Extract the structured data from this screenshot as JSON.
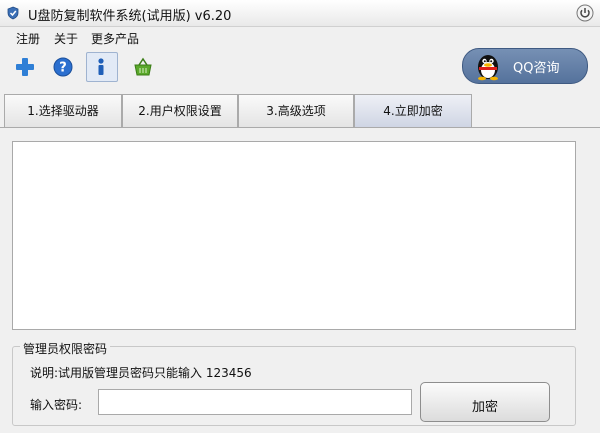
{
  "window": {
    "title": "U盘防复制软件系统(试用版) v6.20",
    "app_icon": "shield-icon",
    "close_icon": "power-icon"
  },
  "menu": {
    "items": [
      {
        "label": "注册"
      },
      {
        "label": "关于"
      },
      {
        "label": "更多产品"
      }
    ]
  },
  "toolbar": {
    "icons": [
      "plus-icon",
      "help-icon",
      "info-icon",
      "basket-icon"
    ],
    "qq_label": "QQ咨询"
  },
  "tabs": [
    {
      "label": "1.选择驱动器"
    },
    {
      "label": "2.用户权限设置"
    },
    {
      "label": "3.高级选项"
    },
    {
      "label": "4.立即加密",
      "active": true
    }
  ],
  "admin_group": {
    "title": "管理员权限密码",
    "hint": "说明:试用版管理员密码只能输入 123456",
    "password_label": "输入密码:",
    "password_value": "",
    "encrypt_label": "加密"
  },
  "colors": {
    "qq_button": "#607ca6",
    "active_tab": "#dde1ec"
  }
}
